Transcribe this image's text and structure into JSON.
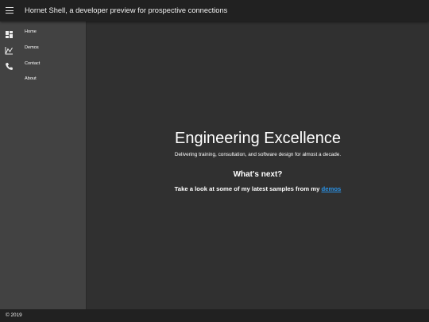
{
  "header": {
    "menu_icon": "hamburger-menu-icon",
    "title": "Hornet Shell, a developer preview for prospective connections"
  },
  "sidebar": {
    "items": [
      {
        "label": "Home",
        "icon": "dashboard-icon"
      },
      {
        "label": "Demos",
        "icon": "chart-icon"
      },
      {
        "label": "Contact",
        "icon": "phone-icon"
      },
      {
        "label": "About",
        "icon": ""
      }
    ]
  },
  "main": {
    "hero_title": "Engineering Excellence",
    "hero_subtitle": "Delivering training, consultation, and software design for almost a decade.",
    "next_title": "What's next?",
    "next_text": "Take a look at some of my latest samples from my ",
    "next_link": "demos"
  },
  "footer": {
    "text": "© 2019"
  },
  "colors": {
    "topbar": "#212121",
    "sidebar": "#424242",
    "content": "#303030",
    "link": "#2a93e8"
  }
}
